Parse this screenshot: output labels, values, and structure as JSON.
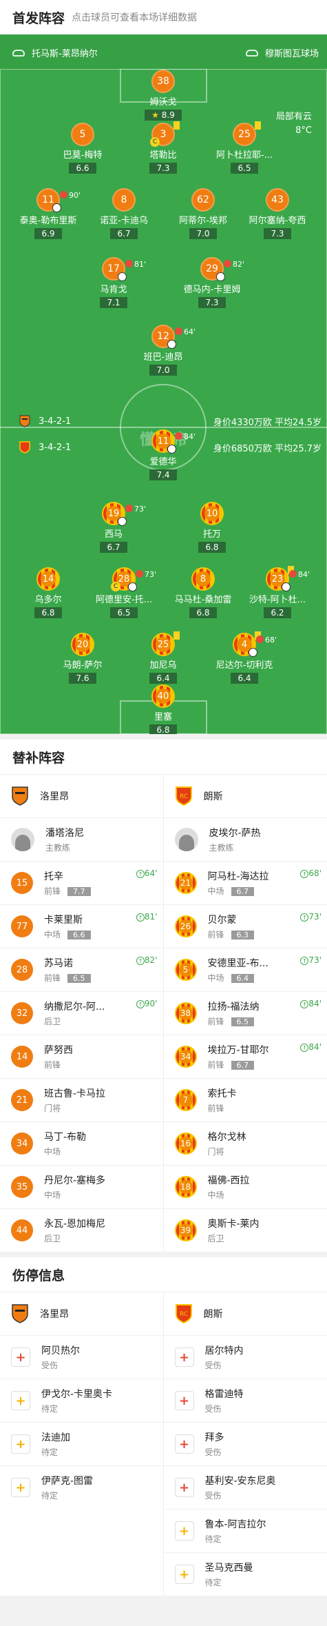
{
  "header": {
    "title": "首发阵容",
    "subtitle": "点击球员可查看本场详细数据"
  },
  "pitch": {
    "home_venue_label": "托马斯-莱昂纳尔",
    "away_venue_label": "穆斯图瓦球场",
    "weather_line1": "局部有云",
    "weather_line2": "8°C",
    "watermark": "懂球帝",
    "home_formation": "3-4-2-1",
    "home_worth": "身价4330万欧 平均24.5岁",
    "away_formation": "3-4-2-1",
    "away_worth": "身价6850万欧 平均25.7岁",
    "home_players": [
      {
        "num": "38",
        "name": "姆沃戈",
        "rating": "8.9",
        "star": true
      },
      {
        "num": "5",
        "name": "巴莫-梅特",
        "rating": "6.6"
      },
      {
        "num": "3",
        "name": "塔勒比",
        "rating": "7.3",
        "captain": "C",
        "yellow": true
      },
      {
        "num": "25",
        "name": "阿卜杜拉耶-...",
        "rating": "6.5",
        "yellow": true
      },
      {
        "num": "11",
        "name": "泰奥-勒布里斯",
        "rating": "6.9",
        "sub": "90'"
      },
      {
        "num": "8",
        "name": "诺亚-卡迪乌",
        "rating": "6.7"
      },
      {
        "num": "62",
        "name": "阿蒂尔-埃邦",
        "rating": "7.0"
      },
      {
        "num": "43",
        "name": "阿尔塞纳-夸西",
        "rating": "7.3"
      },
      {
        "num": "17",
        "name": "马肯戈",
        "rating": "7.1",
        "sub": "81'"
      },
      {
        "num": "29",
        "name": "德马内-卡里姆",
        "rating": "7.3",
        "sub": "82'"
      },
      {
        "num": "12",
        "name": "班巴-迪昂",
        "rating": "7.0",
        "sub": "64'"
      }
    ],
    "away_players": [
      {
        "num": "11",
        "name": "爱德华",
        "rating": "7.4",
        "sub": "84'"
      },
      {
        "num": "19",
        "name": "西马",
        "rating": "6.7",
        "sub": "73'"
      },
      {
        "num": "10",
        "name": "托万",
        "rating": "6.8"
      },
      {
        "num": "14",
        "name": "乌多尔",
        "rating": "6.8"
      },
      {
        "num": "28",
        "name": "阿德里安-托...",
        "rating": "6.5",
        "sub": "73'",
        "captain": "C"
      },
      {
        "num": "8",
        "name": "马马杜-桑加雷",
        "rating": "6.8"
      },
      {
        "num": "23",
        "name": "沙特-阿卜杜...",
        "rating": "6.2",
        "sub": "84'",
        "yellow": true
      },
      {
        "num": "20",
        "name": "马朗-萨尔",
        "rating": "7.6"
      },
      {
        "num": "25",
        "name": "加尼乌",
        "rating": "6.4",
        "yellow": true
      },
      {
        "num": "4",
        "name": "尼达尔-切利克",
        "rating": "6.4",
        "sub": "68'",
        "yellow": true
      },
      {
        "num": "40",
        "name": "里塞",
        "rating": "6.8"
      }
    ]
  },
  "subs": {
    "title": "替补阵容",
    "home_team": "洛里昂",
    "away_team": "朗斯",
    "home_coach": {
      "name": "潘塔洛尼",
      "role": "主教练"
    },
    "away_coach": {
      "name": "皮埃尔-萨热",
      "role": "主教练"
    },
    "home": [
      {
        "num": "15",
        "name": "托辛",
        "pos": "前锋",
        "rating": "7.7",
        "time": "64'"
      },
      {
        "num": "77",
        "name": "卡莱里斯",
        "pos": "中场",
        "rating": "6.6",
        "time": "81'"
      },
      {
        "num": "28",
        "name": "苏马诺",
        "pos": "前锋",
        "rating": "6.5",
        "time": "82'"
      },
      {
        "num": "32",
        "name": "纳撒尼尔-阿...",
        "pos": "后卫",
        "rating": "",
        "time": "90'"
      },
      {
        "num": "14",
        "name": "萨努西",
        "pos": "前锋",
        "rating": "",
        "time": ""
      },
      {
        "num": "21",
        "name": "班古鲁-卡马拉",
        "pos": "门将",
        "rating": "",
        "time": ""
      },
      {
        "num": "34",
        "name": "马丁-布勒",
        "pos": "中场",
        "rating": "",
        "time": ""
      },
      {
        "num": "35",
        "name": "丹尼尔-塞梅多",
        "pos": "中场",
        "rating": "",
        "time": ""
      },
      {
        "num": "44",
        "name": "永瓦-恩加梅尼",
        "pos": "后卫",
        "rating": "",
        "time": ""
      }
    ],
    "away": [
      {
        "num": "21",
        "name": "阿马杜-海达拉",
        "pos": "中场",
        "rating": "6.7",
        "time": "68'"
      },
      {
        "num": "26",
        "name": "贝尔蒙",
        "pos": "前锋",
        "rating": "6.3",
        "time": "73'"
      },
      {
        "num": "5",
        "name": "安德里亚-布...",
        "pos": "中场",
        "rating": "6.4",
        "time": "73'"
      },
      {
        "num": "38",
        "name": "拉扬-福法纳",
        "pos": "前锋",
        "rating": "6.5",
        "time": "84'"
      },
      {
        "num": "34",
        "name": "埃拉万-甘耶尔",
        "pos": "前锋",
        "rating": "6.7",
        "time": "84'"
      },
      {
        "num": "7",
        "name": "索托卡",
        "pos": "前锋",
        "rating": "",
        "time": ""
      },
      {
        "num": "16",
        "name": "格尔戈林",
        "pos": "门将",
        "rating": "",
        "time": ""
      },
      {
        "num": "18",
        "name": "福佛-西拉",
        "pos": "中场",
        "rating": "",
        "time": ""
      },
      {
        "num": "39",
        "name": "奥斯卡-莱内",
        "pos": "后卫",
        "rating": "",
        "time": ""
      }
    ]
  },
  "injuries": {
    "title": "伤停信息",
    "home_team": "洛里昂",
    "away_team": "朗斯",
    "home": [
      {
        "name": "阿贝热尔",
        "status": "受伤",
        "type": "injured"
      },
      {
        "name": "伊戈尔-卡里奥卡",
        "status": "待定",
        "type": "doubt"
      },
      {
        "name": "法迪加",
        "status": "待定",
        "type": "doubt"
      },
      {
        "name": "伊萨克-图雷",
        "status": "待定",
        "type": "doubt"
      }
    ],
    "away": [
      {
        "name": "居尔特内",
        "status": "受伤",
        "type": "injured"
      },
      {
        "name": "格雷迪特",
        "status": "受伤",
        "type": "injured"
      },
      {
        "name": "拜多",
        "status": "受伤",
        "type": "injured"
      },
      {
        "name": "基利安-安东尼奥",
        "status": "受伤",
        "type": "injured"
      },
      {
        "name": "鲁本-阿吉拉尔",
        "status": "待定",
        "type": "doubt"
      },
      {
        "name": "圣马克西曼",
        "status": "待定",
        "type": "doubt"
      }
    ]
  },
  "colors": {
    "pitch": "#3aa84a",
    "home": "#f07d12",
    "away_red": "#e63c14",
    "away_yellow": "#f7c500",
    "rating_bg": "#2a6a36"
  }
}
